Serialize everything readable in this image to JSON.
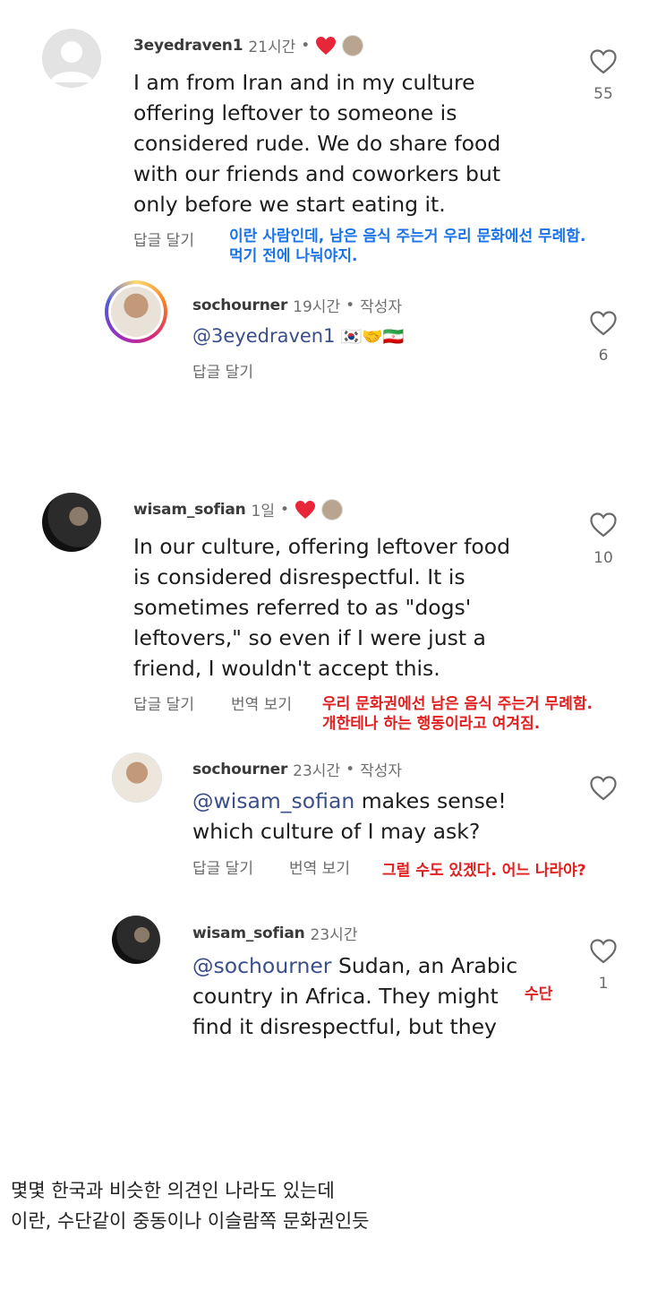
{
  "comment1": {
    "username": "3eyedraven1",
    "time": "21시간",
    "dot": "•",
    "text_lines": [
      "I am from Iran and in my culture",
      "offering leftover to someone is",
      "considered rude. We do share food",
      "with our friends and coworkers but",
      "only before we start eating it."
    ],
    "reply_label": "답글 달기",
    "likes": "55",
    "annotation_lines": [
      "이란 사람인데, 남은 음식 주는거 우리 문화에선 무례함.",
      "먹기 전에 나눠야지."
    ]
  },
  "reply1": {
    "username": "sochourner",
    "time": "19시간",
    "dot": "•",
    "author_tag": "작성자",
    "mention": "@3eyedraven1",
    "emoji": "🇰🇷🤝🇮🇷",
    "reply_label": "답글 달기",
    "likes": "6"
  },
  "comment2": {
    "username": "wisam_sofian",
    "time": "1일",
    "dot": "•",
    "text_lines": [
      "In our culture, offering leftover food",
      "is considered disrespectful. It is",
      "sometimes referred to as \"dogs'",
      "leftovers,\" so even if I were just a",
      "friend, I wouldn't accept this."
    ],
    "reply_label": "답글 달기",
    "translate_label": "번역 보기",
    "likes": "10",
    "annotation_lines": [
      "우리 문화권에선 남은 음식 주는거 무례함.",
      "개한테나 하는 행동이라고 여겨짐."
    ]
  },
  "reply2": {
    "username": "sochourner",
    "time": "23시간",
    "dot": "•",
    "author_tag": "작성자",
    "mention": "@wisam_sofian",
    "text_line1_rest": " makes sense!",
    "text_line2": "which culture of I may ask?",
    "reply_label": "답글 달기",
    "translate_label": "번역 보기",
    "annotation": "그럴 수도 있겠다. 어느 나라야?"
  },
  "reply3": {
    "username": "wisam_sofian",
    "time": "23시간",
    "mention": "@sochourner",
    "text_line1_rest": " Sudan, an Arabic",
    "text_line2": "country in Africa. They might",
    "text_line3": "find it disrespectful, but they",
    "likes": "1",
    "annotation": "수단"
  },
  "bottom_caption": {
    "line1": "몇몇 한국과 비슷한 의견인 나라도 있는데",
    "line2": "이란, 수단같이 중동이나 이슬람쪽 문화권인듯"
  },
  "colors": {
    "heart_red": "#e8263a",
    "annotation_blue": "#1a73e8",
    "annotation_red": "#e02020",
    "story_ring": "#d6249f"
  }
}
